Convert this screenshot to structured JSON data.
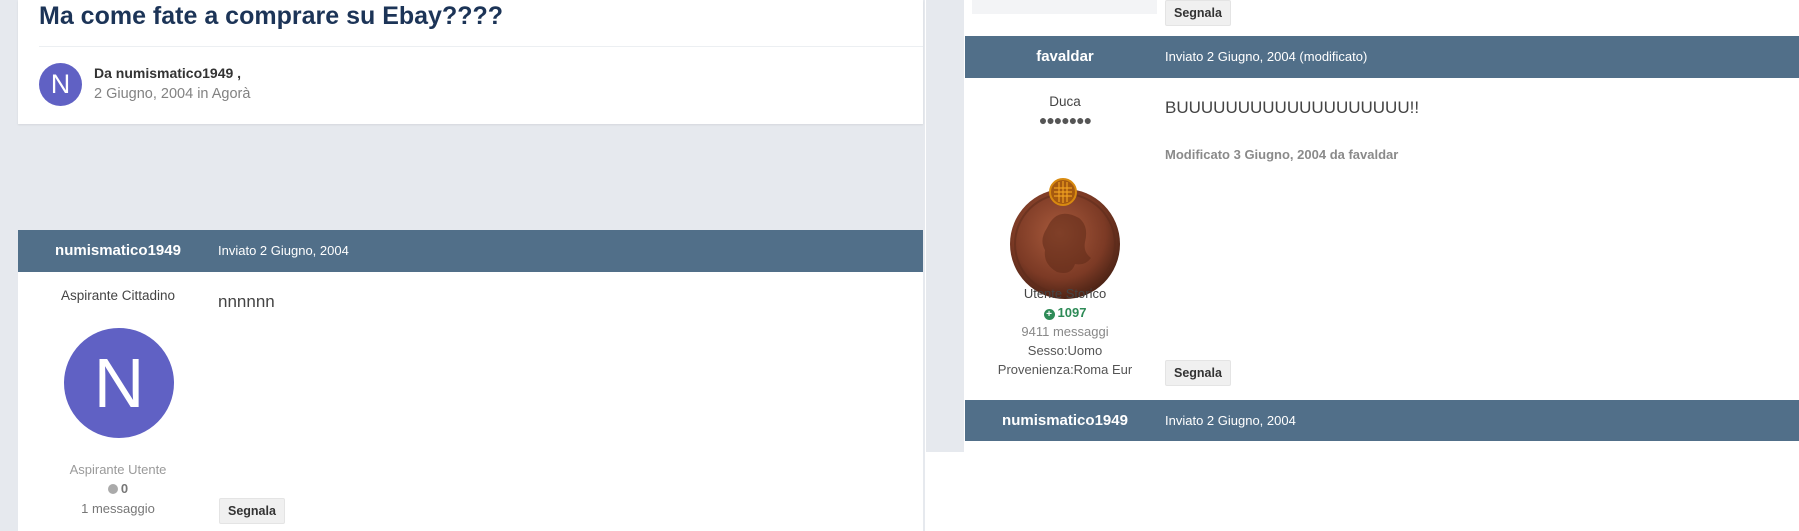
{
  "topic": {
    "title": "Ma come fate a comprare su Ebay????",
    "author_initial": "N",
    "by_line": "Da numismatico1949 ,",
    "date_line": "2 Giugno, 2004 in Agorà"
  },
  "post1": {
    "username": "numismatico1949",
    "posted": "Inviato 2 Giugno, 2004",
    "rank": "Aspirante Cittadino",
    "avatar_initial": "N",
    "group": "Aspirante Utente",
    "reputation": "0",
    "messages": "1 messaggio",
    "content": "nnnnnn",
    "report_label": "Segnala"
  },
  "prev_report_label": "Segnala",
  "post2": {
    "username": "favaldar",
    "posted": "Inviato 2 Giugno, 2004 (modificato)",
    "rank": "Duca",
    "rank_pips": "●●●●●●●",
    "group": "Utente Storico",
    "reputation": "1097",
    "messages": "9411 messaggi",
    "sex": "Sesso:Uomo",
    "location": "Provenienza:Roma Eur",
    "content": "BUUUUUUUUUUUUUUUUUUU!!",
    "edited_note": "Modificato 3 Giugno, 2004 da favaldar",
    "report_label": "Segnala"
  },
  "post3": {
    "username": "numismatico1949",
    "posted": "Inviato 2 Giugno, 2004"
  },
  "colors": {
    "header_bar": "#516f89",
    "avatar": "#6061c4",
    "title": "#1c3457",
    "reputation_positive": "#2e8b57",
    "background": "#e6e9ee"
  },
  "icons": {
    "reputation_neutral": "circle-icon",
    "reputation_positive": "plus-circle-icon",
    "avatar_coin": "coin-avatar-icon"
  }
}
